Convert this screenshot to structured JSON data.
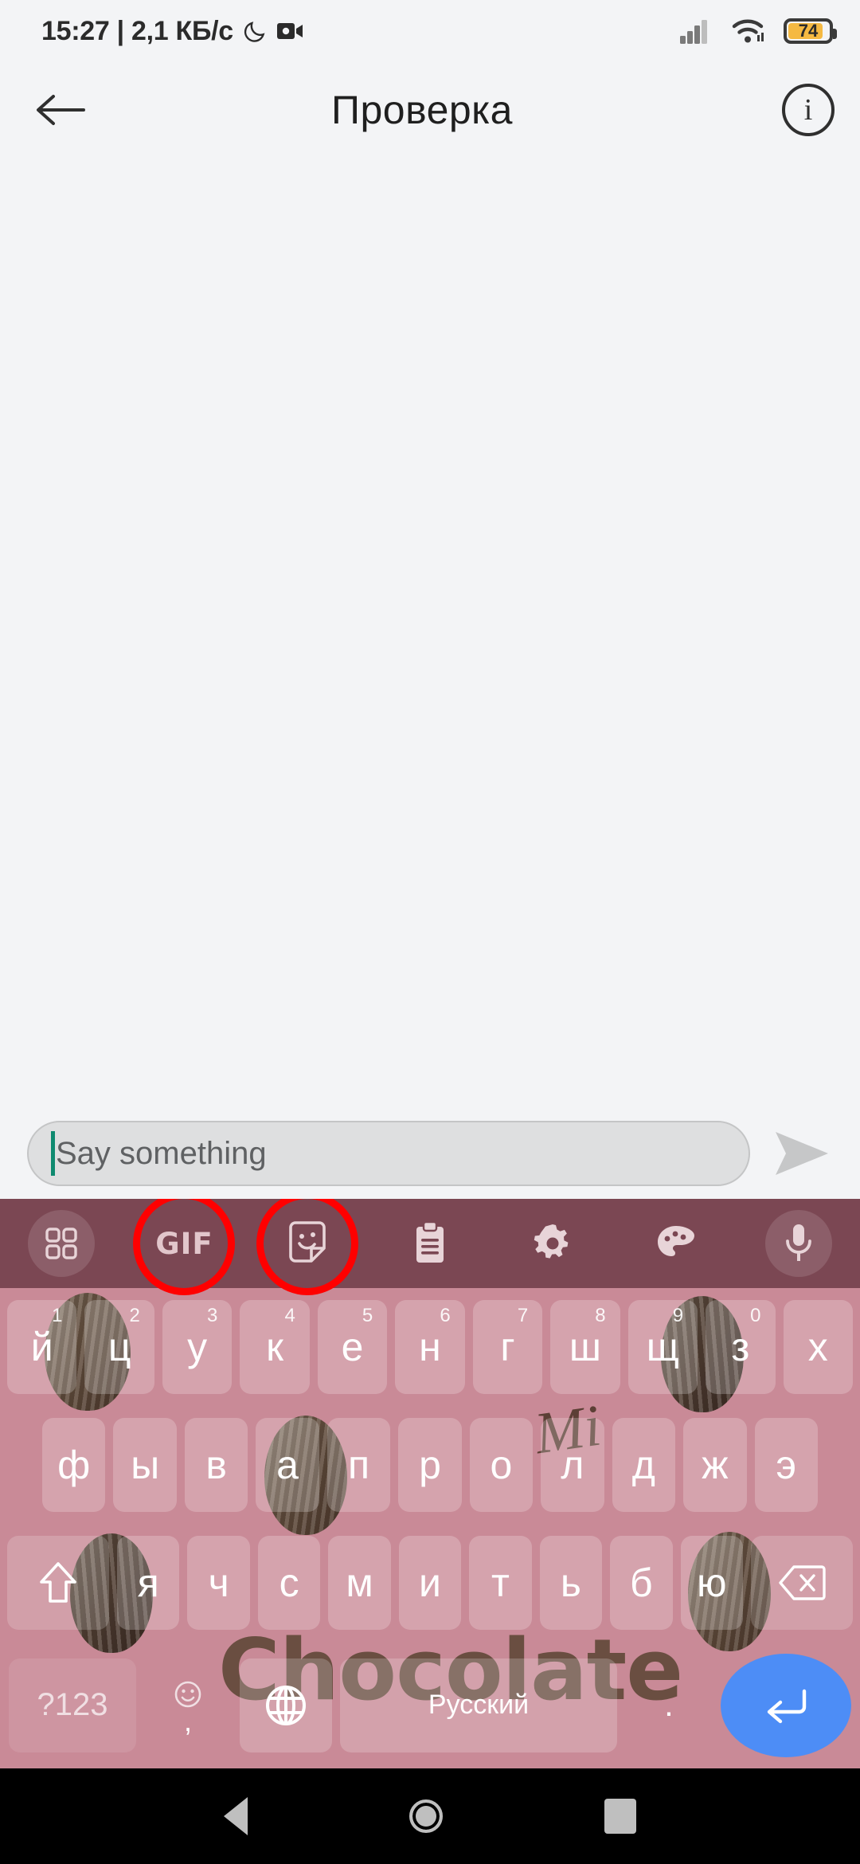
{
  "status_bar": {
    "time": "15:27",
    "separator": "|",
    "network_speed": "2,1 КБ/с",
    "dnd_icon": "moon-icon",
    "recording_icon": "screen-record-icon",
    "signal_icon": "cellular-signal-icon",
    "wifi_icon": "wifi-icon",
    "battery_percent": "74",
    "battery_icon": "battery-icon"
  },
  "app_bar": {
    "back_icon": "back-arrow-icon",
    "title": "Проверка",
    "info_icon": "info-icon",
    "info_glyph": "i"
  },
  "composer": {
    "placeholder": "Say something",
    "value": "",
    "caret_color": "#0f8a70",
    "send_icon": "send-icon"
  },
  "keyboard": {
    "theme_name": "Chocolate",
    "watermark_text": "Chocolate",
    "brand_mark": "Mi",
    "toolbar_bg": "#7b4753",
    "keyboard_bg": "#c98a97",
    "enter_key_color": "#4d8df6",
    "annotation_color": "#ff0000",
    "toolbar": [
      {
        "name": "menu-grid-icon",
        "label": "",
        "annotated": false,
        "round": true
      },
      {
        "name": "gif-icon",
        "label": "GIF",
        "annotated": true,
        "round": false
      },
      {
        "name": "sticker-icon",
        "label": "",
        "annotated": true,
        "round": false
      },
      {
        "name": "clipboard-icon",
        "label": "",
        "annotated": false,
        "round": false
      },
      {
        "name": "settings-gear-icon",
        "label": "",
        "annotated": false,
        "round": false
      },
      {
        "name": "theme-palette-icon",
        "label": "",
        "annotated": false,
        "round": false
      },
      {
        "name": "microphone-icon",
        "label": "",
        "annotated": false,
        "round": true
      }
    ],
    "row1": [
      {
        "main": "й",
        "sup": "1"
      },
      {
        "main": "ц",
        "sup": "2"
      },
      {
        "main": "у",
        "sup": "3"
      },
      {
        "main": "к",
        "sup": "4"
      },
      {
        "main": "е",
        "sup": "5"
      },
      {
        "main": "н",
        "sup": "6"
      },
      {
        "main": "г",
        "sup": "7"
      },
      {
        "main": "ш",
        "sup": "8"
      },
      {
        "main": "щ",
        "sup": "9"
      },
      {
        "main": "з",
        "sup": "0"
      },
      {
        "main": "х",
        "sup": ""
      }
    ],
    "row2": [
      {
        "main": "ф",
        "sup": ""
      },
      {
        "main": "ы",
        "sup": ""
      },
      {
        "main": "в",
        "sup": ""
      },
      {
        "main": "а",
        "sup": ""
      },
      {
        "main": "п",
        "sup": ""
      },
      {
        "main": "р",
        "sup": ""
      },
      {
        "main": "о",
        "sup": ""
      },
      {
        "main": "л",
        "sup": ""
      },
      {
        "main": "д",
        "sup": ""
      },
      {
        "main": "ж",
        "sup": ""
      },
      {
        "main": "э",
        "sup": ""
      }
    ],
    "row3_letters": [
      {
        "main": "я",
        "sup": ""
      },
      {
        "main": "ч",
        "sup": ""
      },
      {
        "main": "с",
        "sup": ""
      },
      {
        "main": "м",
        "sup": ""
      },
      {
        "main": "и",
        "sup": ""
      },
      {
        "main": "т",
        "sup": ""
      },
      {
        "main": "ь",
        "sup": ""
      },
      {
        "main": "б",
        "sup": ""
      },
      {
        "main": "ю",
        "sup": ""
      }
    ],
    "shift_key": "shift-key-icon",
    "backspace_key": "backspace-key-icon",
    "row4": {
      "symbols_label": "?123",
      "comma_label": ",",
      "emoji_icon": "emoji-icon",
      "language_icon": "globe-language-icon",
      "space_label": "Русский",
      "period_label": ".",
      "enter_icon": "enter-key-icon"
    }
  },
  "nav_bar": {
    "back": "nav-back-icon",
    "home": "nav-home-icon",
    "recents": "nav-recents-icon"
  }
}
